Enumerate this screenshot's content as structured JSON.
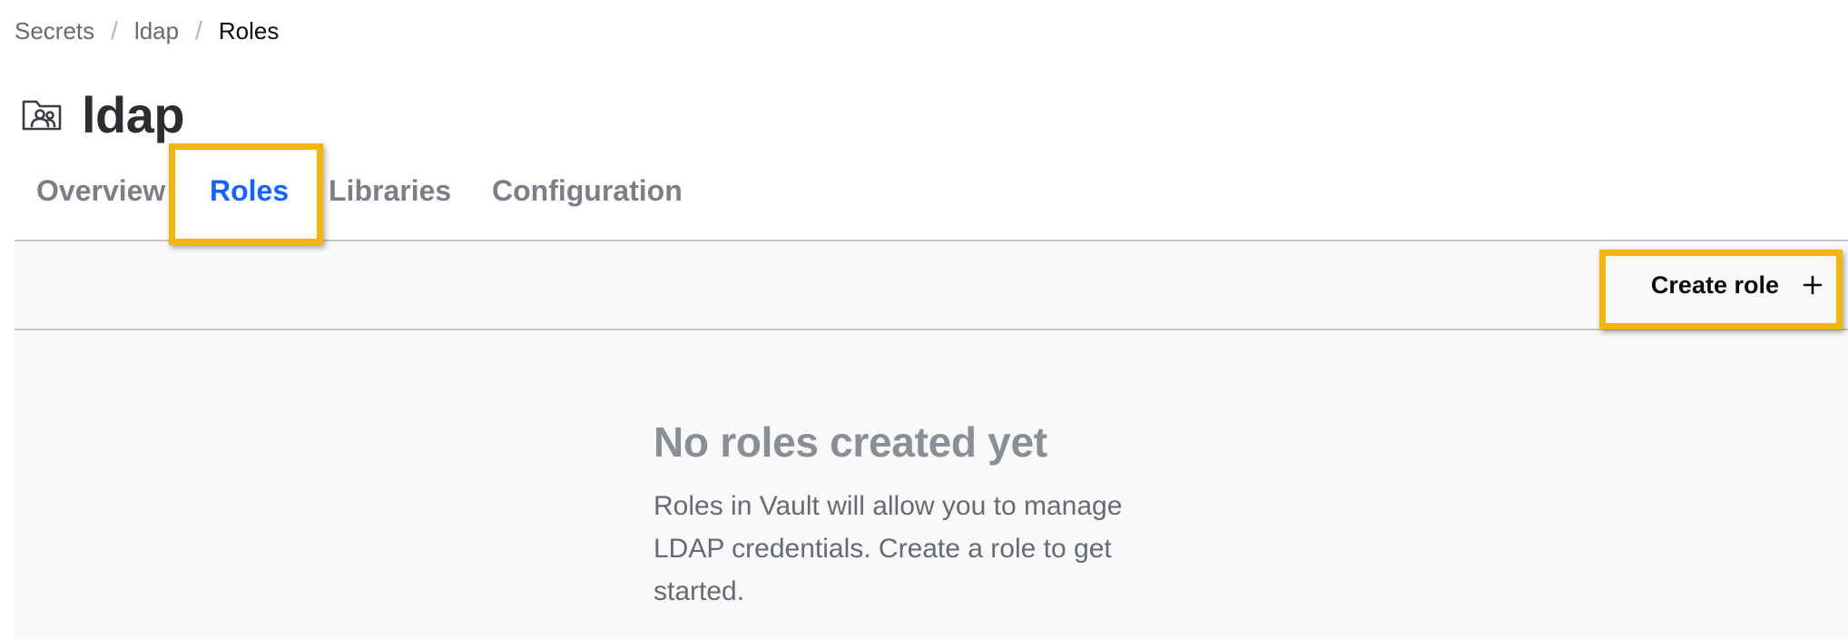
{
  "breadcrumb": {
    "items": [
      "Secrets",
      "ldap",
      "Roles"
    ],
    "separator": "/"
  },
  "header": {
    "icon": "folder-users-icon",
    "title": "ldap"
  },
  "tabs": [
    {
      "label": "Overview",
      "active": false
    },
    {
      "label": "Roles",
      "active": true
    },
    {
      "label": "Libraries",
      "active": false
    },
    {
      "label": "Configuration",
      "active": false
    }
  ],
  "toolbar": {
    "create_label": "Create role",
    "create_icon": "plus-icon"
  },
  "empty_state": {
    "title": "No roles created yet",
    "message_lines": [
      "Roles in Vault will allow you to manage",
      "LDAP credentials. Create a role to get",
      "started."
    ]
  },
  "colors": {
    "accent": "#1563ff",
    "highlight": "#f5b40a"
  }
}
